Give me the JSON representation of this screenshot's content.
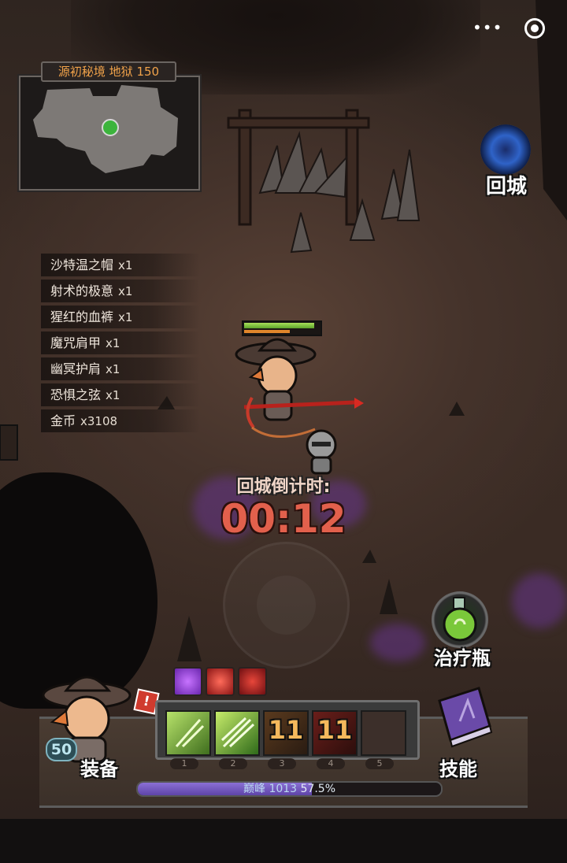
{
  "capsule": {
    "more_icon": "more-icon",
    "close_icon": "target-icon"
  },
  "minimap": {
    "title": "源初秘境 地狱 150"
  },
  "return_button": {
    "label": "回城",
    "icon": "portal-icon"
  },
  "loot": [
    {
      "name": "沙特温之帽",
      "qty": "x1"
    },
    {
      "name": "射术的极意",
      "qty": "x1"
    },
    {
      "name": "猩红的血裤",
      "qty": "x1"
    },
    {
      "name": "魔咒肩甲",
      "qty": "x1"
    },
    {
      "name": "幽冥护肩",
      "qty": "x1"
    },
    {
      "name": "恐惧之弦",
      "qty": "x1"
    },
    {
      "name": "金币",
      "qty": "x3108"
    }
  ],
  "hero": {
    "hp_fraction": 0.95,
    "mana_fraction": 0.62
  },
  "countdown": {
    "label": "回城倒计时:",
    "time": "00:12"
  },
  "potion": {
    "label": "治疗瓶",
    "icon": "potion-icon"
  },
  "buffs": [
    {
      "icon": "heart-buff-icon",
      "color": "#8a3bd0"
    },
    {
      "icon": "arrow-buff-icon",
      "color": "#c8262a"
    },
    {
      "icon": "bow-buff-icon",
      "color": "#b01e22"
    }
  ],
  "hud": {
    "level": "50",
    "equip_label": "装备",
    "alert": "!",
    "skill_label": "技能",
    "slots": [
      {
        "num": "1",
        "cooldown": "",
        "icon": "arrow-rain-icon"
      },
      {
        "num": "2",
        "cooldown": "",
        "icon": "triple-arrow-icon"
      },
      {
        "num": "3",
        "cooldown": "11",
        "icon": "power-shot-icon"
      },
      {
        "num": "4",
        "cooldown": "11",
        "icon": "fire-arrow-icon"
      },
      {
        "num": "5",
        "cooldown": "",
        "icon": "empty-slot"
      }
    ],
    "xp": {
      "level_name": "巅峰",
      "level_value": "1013",
      "percent_text": "57.5%",
      "fraction": 0.575
    }
  }
}
